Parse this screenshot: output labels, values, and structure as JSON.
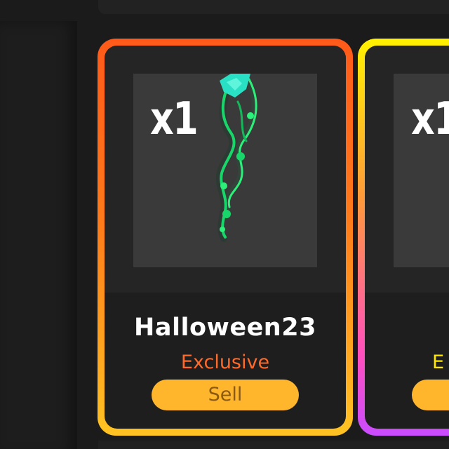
{
  "cards": [
    {
      "quantity": "x1",
      "name": "Halloween23",
      "rarity": "Exclusive",
      "sell_label": "Sell",
      "border_colors": [
        "#ff5a1a",
        "#ffc322"
      ],
      "rarity_color": "#ff6a2a",
      "icon": "green-ghostly-tendril-item"
    },
    {
      "quantity": "x1",
      "rarity": "E",
      "border_colors": [
        "#fff200",
        "#c94cff"
      ],
      "rarity_color": "#ffe600"
    }
  ],
  "colors": {
    "background": "#1b1b1b",
    "sell_button": "#ffb52c",
    "sell_text": "#8a5a14"
  }
}
